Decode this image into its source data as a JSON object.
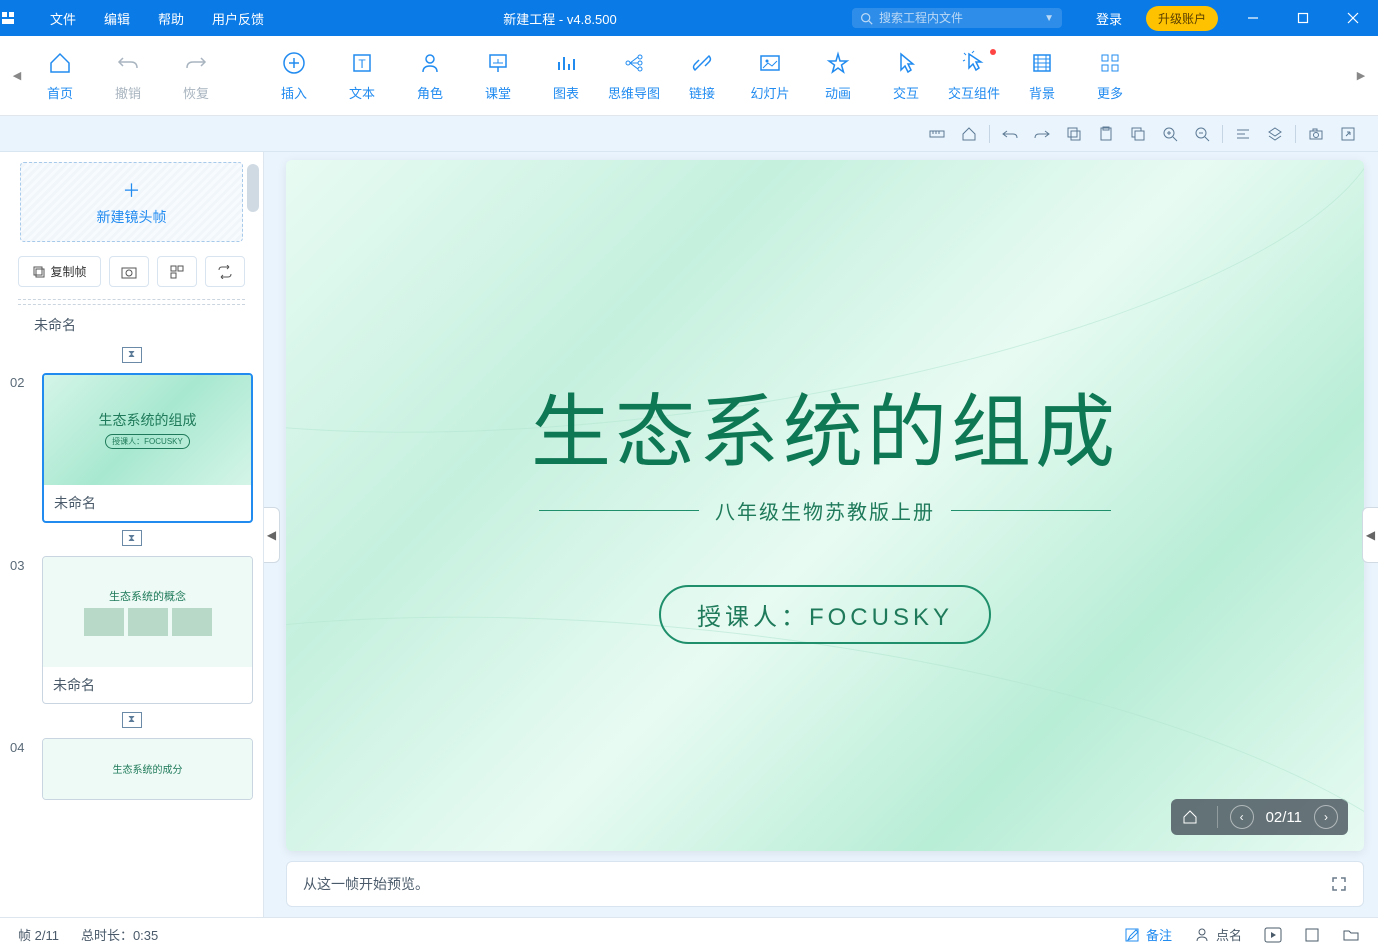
{
  "titlebar": {
    "menus": [
      "文件",
      "编辑",
      "帮助",
      "用户反馈"
    ],
    "title": "新建工程 - v4.8.500",
    "search_placeholder": "搜索工程内文件",
    "login": "登录",
    "upgrade": "升级账户"
  },
  "toolbar": {
    "items": [
      {
        "label": "首页",
        "gray": false,
        "icon": "home"
      },
      {
        "label": "撤销",
        "gray": true,
        "icon": "undo"
      },
      {
        "label": "恢复",
        "gray": true,
        "icon": "redo"
      },
      {
        "label": "插入",
        "gray": false,
        "icon": "plus"
      },
      {
        "label": "文本",
        "gray": false,
        "icon": "text"
      },
      {
        "label": "角色",
        "gray": false,
        "icon": "person"
      },
      {
        "label": "课堂",
        "gray": false,
        "icon": "board"
      },
      {
        "label": "图表",
        "gray": false,
        "icon": "chart"
      },
      {
        "label": "思维导图",
        "gray": false,
        "icon": "mindmap"
      },
      {
        "label": "链接",
        "gray": false,
        "icon": "link"
      },
      {
        "label": "幻灯片",
        "gray": false,
        "icon": "slide"
      },
      {
        "label": "动画",
        "gray": false,
        "icon": "star"
      },
      {
        "label": "交互",
        "gray": false,
        "icon": "cursor"
      },
      {
        "label": "交互组件",
        "gray": false,
        "icon": "component",
        "badge": true
      },
      {
        "label": "背景",
        "gray": false,
        "icon": "bg"
      },
      {
        "label": "更多",
        "gray": false,
        "icon": "more"
      }
    ]
  },
  "sidebar": {
    "new_frame": "新建镜头帧",
    "copy_frame": "复制帧",
    "sections": [
      {
        "num": "",
        "label": "未命名"
      },
      {
        "num": "02",
        "label": "未命名",
        "selected": true,
        "thumb_title": "生态系统的组成",
        "thumb_sub": "授课人：FOCUSKY"
      },
      {
        "num": "03",
        "label": "未命名",
        "thumb_title": "生态系统的概念"
      },
      {
        "num": "04",
        "label": "",
        "thumb_title": "生态系统的成分"
      }
    ]
  },
  "slide": {
    "title": "生态系统的组成",
    "subtitle": "八年级生物苏教版上册",
    "lecturer": "授课人：FOCUSKY",
    "nav_counter": "02/11"
  },
  "preview_text": "从这一帧开始预览。",
  "statusbar": {
    "frame": "帧 2/11",
    "duration": "总时长：0:35",
    "notes": "备注",
    "roll": "点名"
  }
}
